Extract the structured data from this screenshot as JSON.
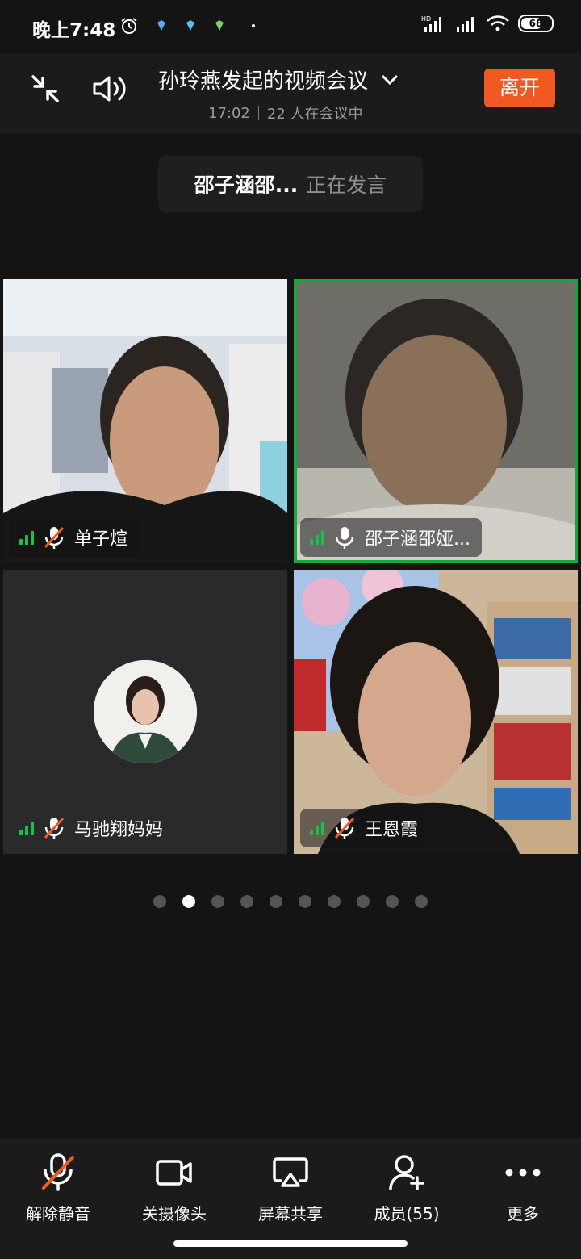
{
  "status_bar": {
    "time": "晚上7:48",
    "battery": "68",
    "network": "HD"
  },
  "header": {
    "title": "孙玲燕发起的视频会议",
    "duration": "17:02",
    "participants_text": "22 人在会议中",
    "leave_label": "离开"
  },
  "speaker": {
    "name": "邵子涵邵...",
    "status": "正在发言"
  },
  "tiles": [
    {
      "name": "单子煊",
      "muted": true
    },
    {
      "name": "邵子涵邵娅...",
      "muted": false,
      "speaking": true
    },
    {
      "name": "马驰翔妈妈",
      "muted": true,
      "video_off": true
    },
    {
      "name": "王恩霞",
      "muted": true
    }
  ],
  "pager": {
    "total": 10,
    "current": 2
  },
  "toolbar": {
    "unmute": "解除静音",
    "camera_off": "关摄像头",
    "share_screen": "屏幕共享",
    "members": "成员(55)",
    "more": "更多"
  },
  "colors": {
    "leave": "#f05a22",
    "active_border": "#13a83e",
    "signal": "#17c24a",
    "mute_slash": "#f05a22"
  }
}
